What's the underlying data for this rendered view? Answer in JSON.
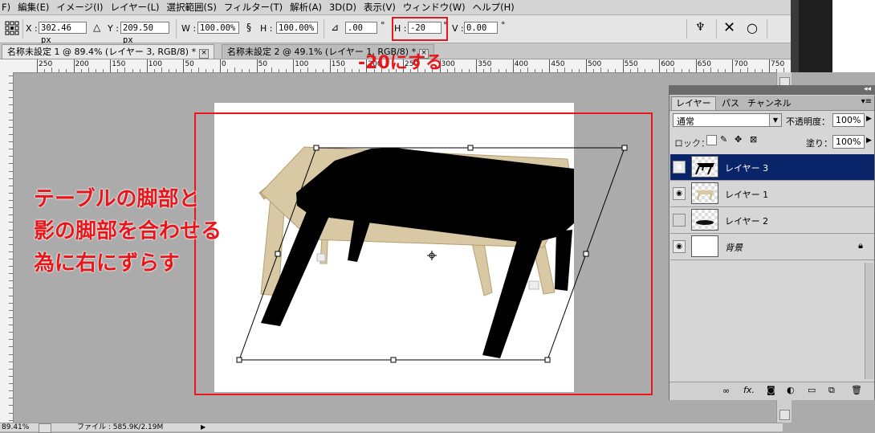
{
  "menu": [
    "F)",
    "編集(E)",
    "イメージ(I)",
    "レイヤー(L)",
    "選択範囲(S)",
    "フィルター(T)",
    "解析(A)",
    "3D(D)",
    "表示(V)",
    "ウィンドウ(W)",
    "ヘルプ(H)"
  ],
  "options": {
    "x_label": "X :",
    "x_value": "302.46 px",
    "y_label": "Y :",
    "y_value": "209.50 px",
    "w_label": "W :",
    "w_value": "100.00%",
    "h_label": "H :",
    "h_value": "100.00%",
    "angle_value": ".00",
    "skew_h_label": "H :",
    "skew_h_value": "-20",
    "skew_v_label": "V :",
    "skew_v_value": "0.00",
    "degree": "°"
  },
  "tabs": [
    {
      "label": "名称未設定 1 @ 89.4% (レイヤー 3, RGB/8) *"
    },
    {
      "label": "名称未設定 2 @ 49.1% (レイヤー 1, RGB/8) *"
    }
  ],
  "ruler_h": [
    "250",
    "200",
    "150",
    "100",
    "50",
    "0",
    "50",
    "100",
    "150",
    "200",
    "250",
    "300",
    "350",
    "400",
    "450",
    "500",
    "550",
    "600",
    "650",
    "700",
    "750"
  ],
  "annotations": {
    "top": "-20にする",
    "left_line1": "テーブルの脚部と",
    "left_line2": "影の脚部を合わせる",
    "left_line3": "為に右にずらす"
  },
  "layers_panel": {
    "tabs": [
      "レイヤー",
      "パス",
      "チャンネル"
    ],
    "blend_mode": "通常",
    "opacity_label": "不透明度：",
    "opacity_value": "100%",
    "lock_label": "ロック：",
    "fill_label": "塗り：",
    "fill_value": "100%",
    "layers": [
      {
        "name": "レイヤー 3",
        "visible": true,
        "selected": true
      },
      {
        "name": "レイヤー 1",
        "visible": true,
        "selected": false
      },
      {
        "name": "レイヤー 2",
        "visible": false,
        "selected": false
      },
      {
        "name": "背景",
        "visible": true,
        "selected": false
      }
    ]
  },
  "status": {
    "zoom": "89.41%",
    "file_info": "ファイル : 585.9K/2.19M"
  },
  "colors": {
    "annotation_red": "#e8161a",
    "selection_blue": "#0a246a"
  }
}
